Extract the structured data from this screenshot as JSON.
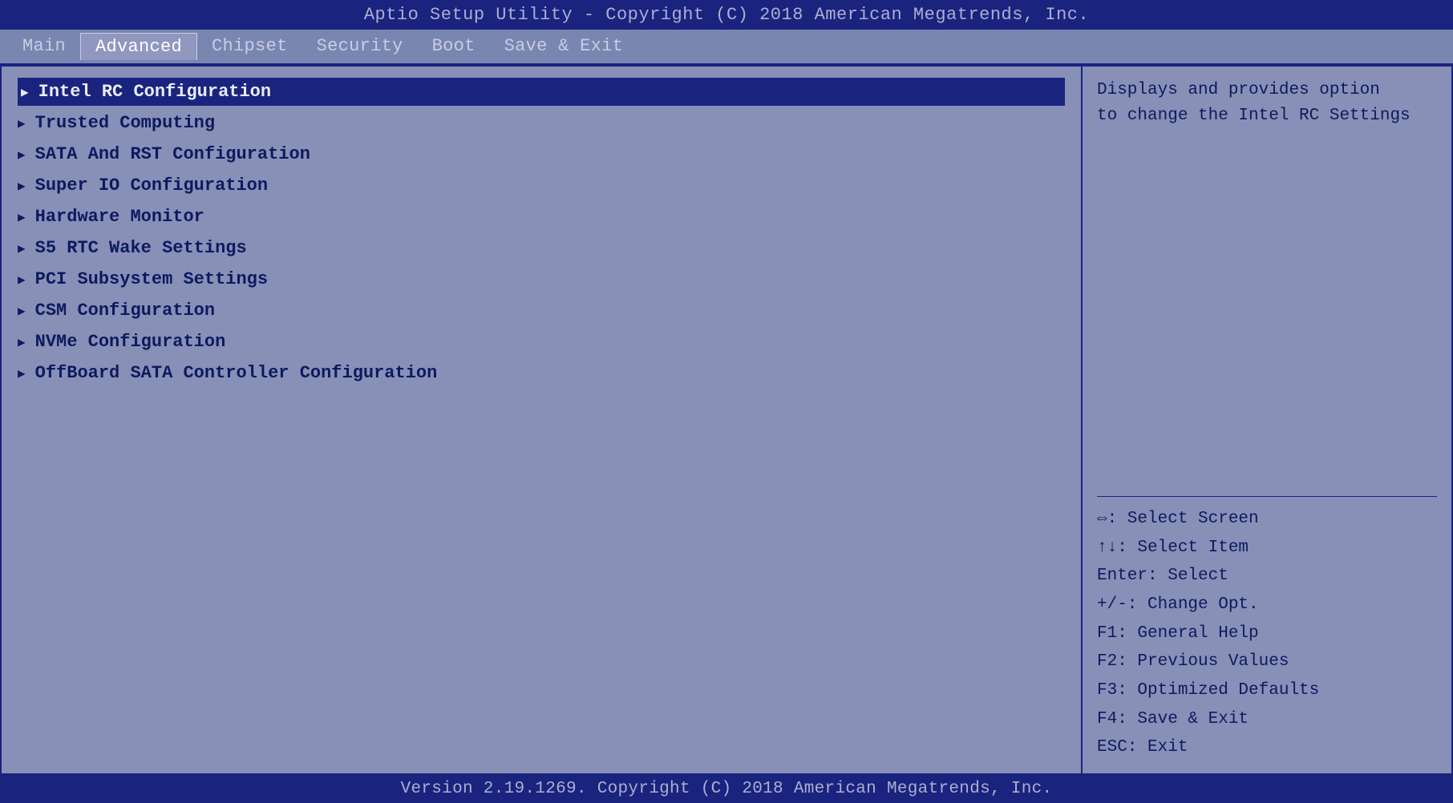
{
  "title_bar": {
    "text": "Aptio Setup Utility - Copyright (C) 2018 American Megatrends, Inc."
  },
  "nav": {
    "items": [
      {
        "label": "Main",
        "active": false
      },
      {
        "label": "Advanced",
        "active": true
      },
      {
        "label": "Chipset",
        "active": false
      },
      {
        "label": "Security",
        "active": false
      },
      {
        "label": "Boot",
        "active": false
      },
      {
        "label": "Save & Exit",
        "active": false
      }
    ]
  },
  "menu": {
    "items": [
      {
        "label": "Intel RC Configuration",
        "selected": true
      },
      {
        "label": "Trusted Computing",
        "selected": false
      },
      {
        "label": "SATA And RST Configuration",
        "selected": false
      },
      {
        "label": "Super IO Configuration",
        "selected": false
      },
      {
        "label": "Hardware Monitor",
        "selected": false
      },
      {
        "label": "S5 RTC Wake Settings",
        "selected": false
      },
      {
        "label": "PCI Subsystem Settings",
        "selected": false
      },
      {
        "label": "CSM Configuration",
        "selected": false
      },
      {
        "label": "NVMe Configuration",
        "selected": false
      },
      {
        "label": "OffBoard SATA Controller Configuration",
        "selected": false
      }
    ]
  },
  "help": {
    "text_line1": "Displays and provides option",
    "text_line2": "to change the Intel RC Settings"
  },
  "key_help": {
    "lines": [
      "⇔: Select Screen",
      "↑↓: Select Item",
      "Enter: Select",
      "+/-: Change Opt.",
      "F1: General Help",
      "F2: Previous Values",
      "F3: Optimized Defaults",
      "F4: Save & Exit",
      "ESC: Exit"
    ]
  },
  "footer": {
    "text": "Version 2.19.1269. Copyright (C) 2018 American Megatrends, Inc."
  }
}
